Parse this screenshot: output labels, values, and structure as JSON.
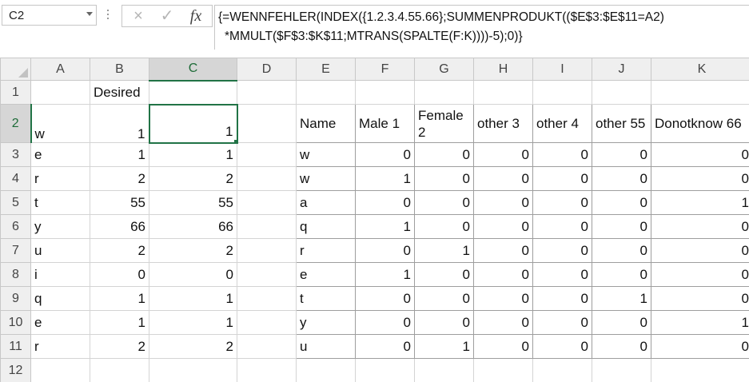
{
  "formula_bar": {
    "name_box": "C2",
    "cancel_icon": "×",
    "enter_icon": "✓",
    "fx_label": "fx",
    "formula_line1": "{=WENNFEHLER(INDEX({1.2.3.4.55.66};SUMMENPRODUKT(($E$3:$E$11=A2)",
    "formula_line2": "*MMULT($F$3:$K$11;MTRANS(SPALTE(F:K))))-5);0)}"
  },
  "grid": {
    "active_cell": "C2",
    "columns": [
      "A",
      "B",
      "C",
      "D",
      "E",
      "F",
      "G",
      "H",
      "I",
      "J",
      "K"
    ],
    "row_numbers": [
      "1",
      "2",
      "3",
      "4",
      "5",
      "6",
      "7",
      "8",
      "9",
      "10",
      "11",
      "12"
    ],
    "b1_header": "Desired",
    "lookup_rows": [
      {
        "a": "w",
        "b": "1",
        "c": "1"
      },
      {
        "a": "e",
        "b": "1",
        "c": "1"
      },
      {
        "a": "r",
        "b": "2",
        "c": "2"
      },
      {
        "a": "t",
        "b": "55",
        "c": "55"
      },
      {
        "a": "y",
        "b": "66",
        "c": "66"
      },
      {
        "a": "u",
        "b": "2",
        "c": "2"
      },
      {
        "a": "i",
        "b": "0",
        "c": "0"
      },
      {
        "a": "q",
        "b": "1",
        "c": "1"
      },
      {
        "a": "e",
        "b": "1",
        "c": "1"
      },
      {
        "a": "r",
        "b": "2",
        "c": "2"
      }
    ],
    "table_headers": [
      "Name",
      "Male 1",
      "Female 2",
      "other 3",
      "other 4",
      "other 55",
      "Donotknow 66"
    ],
    "table_rows": [
      {
        "name": "w",
        "vals": [
          "0",
          "0",
          "0",
          "0",
          "0",
          "0"
        ]
      },
      {
        "name": "w",
        "vals": [
          "1",
          "0",
          "0",
          "0",
          "0",
          "0"
        ]
      },
      {
        "name": "a",
        "vals": [
          "0",
          "0",
          "0",
          "0",
          "0",
          "1"
        ]
      },
      {
        "name": "q",
        "vals": [
          "1",
          "0",
          "0",
          "0",
          "0",
          "0"
        ]
      },
      {
        "name": "r",
        "vals": [
          "0",
          "1",
          "0",
          "0",
          "0",
          "0"
        ]
      },
      {
        "name": "e",
        "vals": [
          "1",
          "0",
          "0",
          "0",
          "0",
          "0"
        ]
      },
      {
        "name": "t",
        "vals": [
          "0",
          "0",
          "0",
          "0",
          "1",
          "0"
        ]
      },
      {
        "name": "y",
        "vals": [
          "0",
          "0",
          "0",
          "0",
          "0",
          "1"
        ]
      },
      {
        "name": "u",
        "vals": [
          "0",
          "1",
          "0",
          "0",
          "0",
          "0"
        ]
      }
    ]
  },
  "colors": {
    "accent": "#217346",
    "header_bg": "#efefef",
    "gridline": "#d4d4d4"
  }
}
